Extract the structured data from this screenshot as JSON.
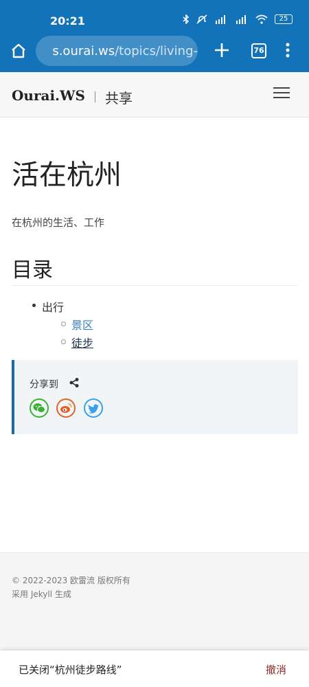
{
  "status_bar": {
    "time": "20:21",
    "battery": "25",
    "icons": [
      "bluetooth-icon",
      "mute-icon",
      "signal-hd-icon",
      "signal-hd-icon",
      "wifi-icon",
      "battery-icon"
    ]
  },
  "browser": {
    "url_host": "s.ourai.ws",
    "url_path": "/topics/living-",
    "tab_count": "76"
  },
  "site": {
    "title": "Ourai.WS",
    "section": "共享"
  },
  "page": {
    "title": "活在杭州",
    "description": "在杭州的生活、工作"
  },
  "toc": {
    "heading": "目录",
    "items": [
      {
        "label": "出行",
        "children": [
          {
            "label": "景区"
          },
          {
            "label": "徒步"
          }
        ]
      }
    ]
  },
  "share": {
    "label": "分享到",
    "targets": [
      {
        "name": "wechat",
        "color": "#3cb034"
      },
      {
        "name": "weibo",
        "color": "#e0632a"
      },
      {
        "name": "twitter",
        "color": "#3aa0e8"
      }
    ]
  },
  "footer": {
    "copyright": "© 2022-2023 欧雷流 版权所有",
    "generator": "采用 Jekyll 生成"
  },
  "snackbar": {
    "message": "已关闭“杭州徒步路线”",
    "action": "撤消"
  }
}
